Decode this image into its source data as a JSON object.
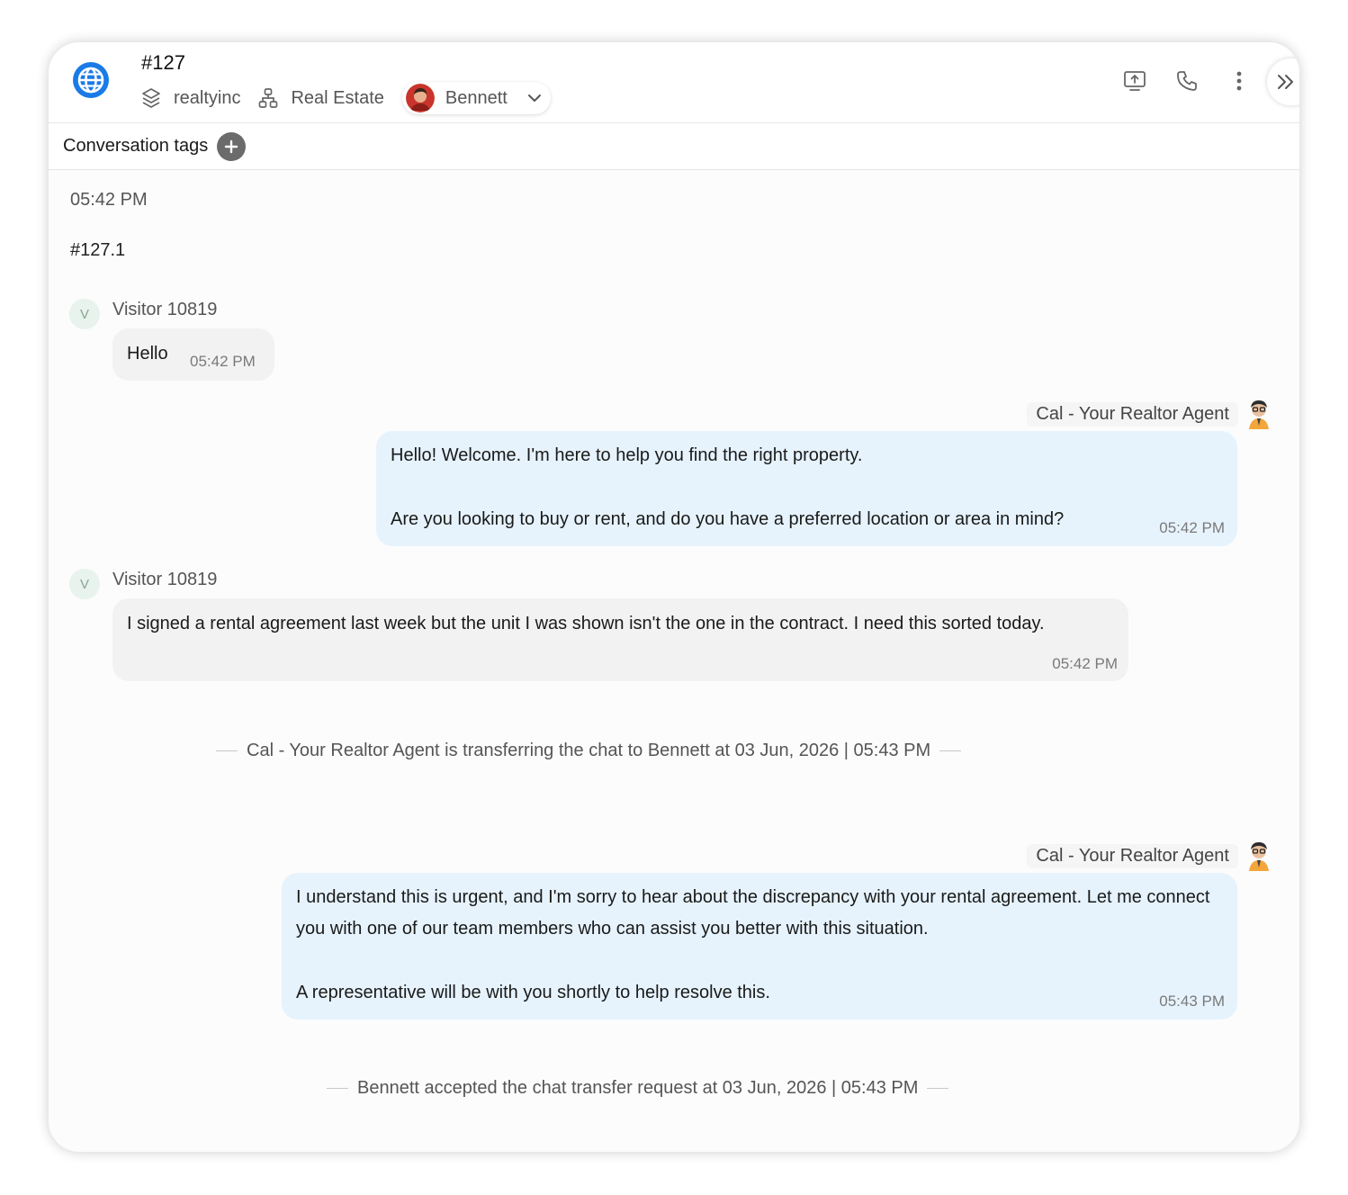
{
  "header": {
    "conversation_id": "#127",
    "workspace": "realtyinc",
    "department": "Real Estate",
    "assigned_agent": "Bennett"
  },
  "tags_bar": {
    "label": "Conversation tags"
  },
  "chat": {
    "start_time": "05:42 PM",
    "sub_conversation_id": "#127.1",
    "messages": [
      {
        "sender": "Visitor 10819",
        "avatar_letter": "V",
        "text": "Hello",
        "time": "05:42 PM"
      },
      {
        "sender": "Cal - Your Realtor Agent",
        "paragraphs": [
          "Hello! Welcome. I'm here to help you find the right property.",
          "Are you looking to buy or rent, and do you have a preferred location or area in mind?"
        ],
        "time": "05:42 PM"
      },
      {
        "sender": "Visitor 10819",
        "avatar_letter": "V",
        "text": "I signed a rental agreement last week but the unit I was shown isn't the one in the contract. I need this sorted today.",
        "time": "05:42 PM"
      },
      {
        "sender": "Cal - Your Realtor Agent",
        "paragraphs": [
          "I understand this is urgent, and I'm sorry to hear about the discrepancy with your rental agreement. Let me connect you with one of our team members who can assist you better with this situation.",
          "A representative will be with you shortly to help resolve this."
        ],
        "time": "05:43 PM"
      }
    ],
    "system_events": {
      "transfer": {
        "from": "Cal - Your Realtor Agent",
        "middle": "is transferring the chat to",
        "to": "Bennett",
        "suffix": "at 03 Jun, 2026 | 05:43 PM"
      },
      "accepted": "Bennett accepted the chat transfer request at 03 Jun, 2026 | 05:43 PM"
    }
  },
  "colors": {
    "accent_blue": "#1a7be6",
    "bot_bubble": "#e6f3fd",
    "visitor_bubble": "#f2f2f2"
  },
  "icons": [
    "globe-icon",
    "layers-icon",
    "org-chart-icon",
    "chevron-down-icon",
    "screen-share-icon",
    "phone-icon",
    "more-vertical-icon",
    "double-chevron-right-icon",
    "plus-icon"
  ]
}
